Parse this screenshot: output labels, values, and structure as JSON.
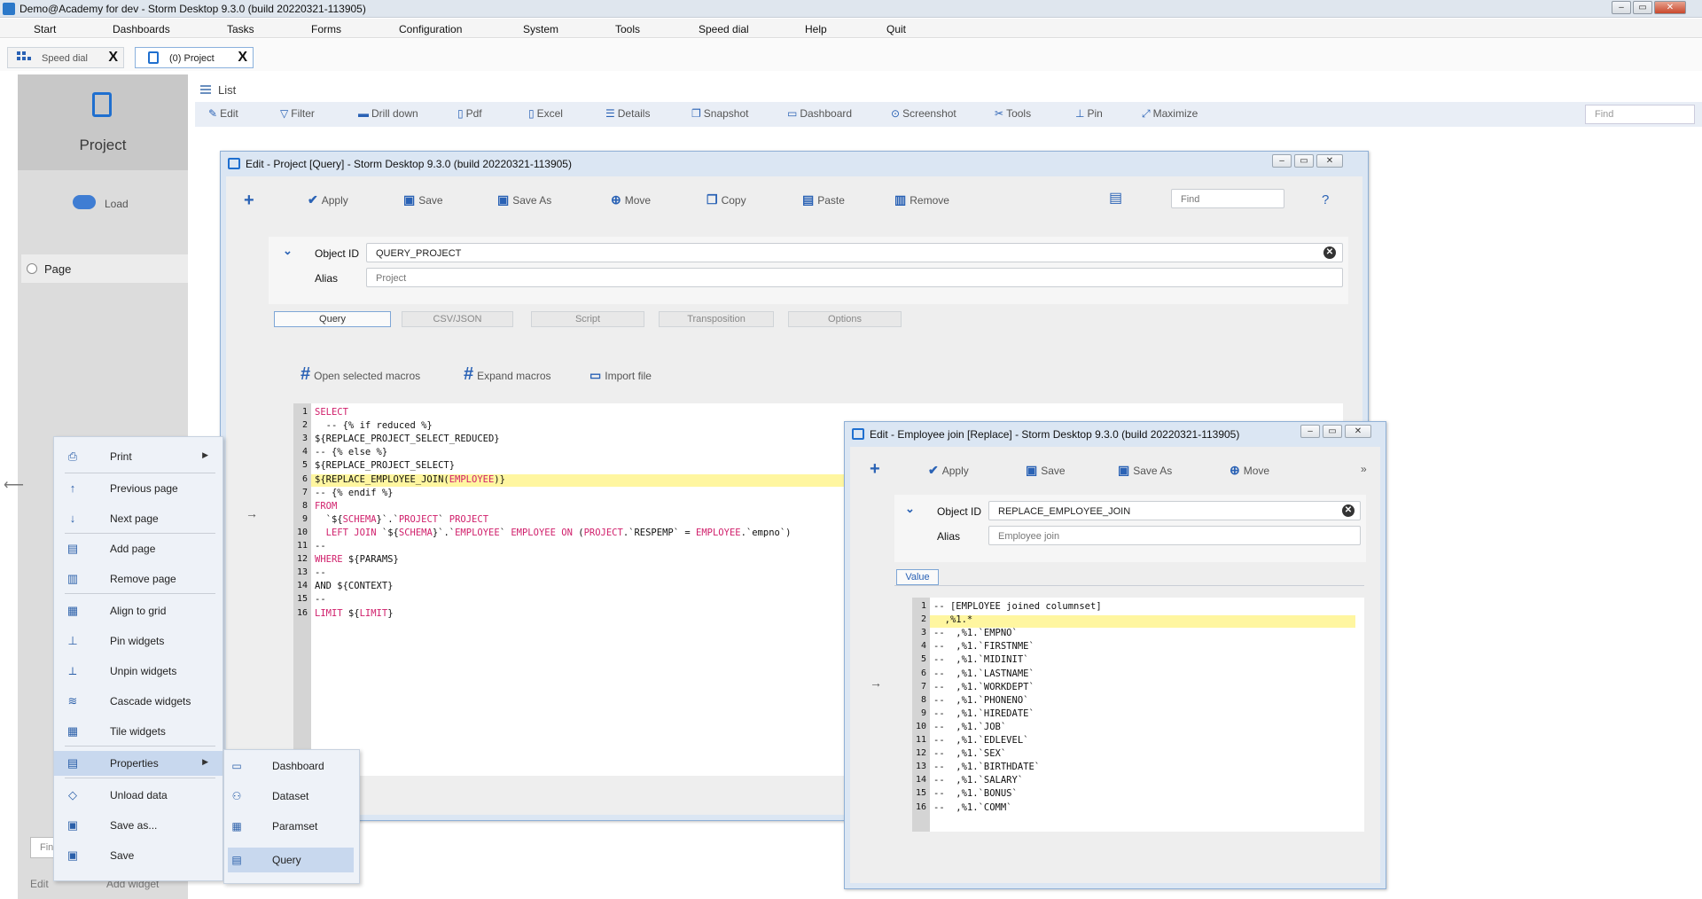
{
  "window": {
    "title": "Demo@Academy for dev -  Storm Desktop 9.3.0 (build 20220321-113905)",
    "controls": [
      "‒",
      "▭",
      "✕"
    ]
  },
  "menu": [
    "Start",
    "Dashboards",
    "Tasks",
    "Forms",
    "Configuration",
    "System",
    "Tools",
    "Speed dial",
    "Help",
    "Quit"
  ],
  "tabs": [
    {
      "label": "Speed dial",
      "close": "X"
    },
    {
      "label": "(0) Project",
      "close": "X"
    }
  ],
  "left_panel": {
    "title": "Project",
    "load_label": "Load",
    "page_label": "Page",
    "find_stub": "Fin",
    "edit_label": "Edit",
    "add_widget_label": "Add widget"
  },
  "list": {
    "label": "List",
    "toolbar": [
      "Edit",
      "Filter",
      "Drill down",
      "Pdf",
      "Excel",
      "Details",
      "Snapshot",
      "Dashboard",
      "Screenshot",
      "Tools",
      "Pin",
      "Maximize"
    ],
    "find_placeholder": "Find"
  },
  "dialog_project": {
    "title": "Edit - Project [Query] -  Storm Desktop 9.3.0 (build 20220321-113905)",
    "toolbar": [
      "Apply",
      "Save",
      "Save As",
      "Move",
      "Copy",
      "Paste",
      "Remove"
    ],
    "find_placeholder": "Find",
    "help": "?",
    "object_id_label": "Object ID",
    "object_id_value": "QUERY_PROJECT",
    "alias_label": "Alias",
    "alias_placeholder": "Project",
    "subtabs": [
      "Query",
      "CSV/JSON",
      "Script",
      "Transposition",
      "Options"
    ],
    "macros": [
      "Open selected macros",
      "Expand macros",
      "Import file"
    ],
    "code": [
      "SELECT",
      "  -- {% if reduced %}",
      "${REPLACE_PROJECT_SELECT_REDUCED}",
      "-- {% else %}",
      "${REPLACE_PROJECT_SELECT}",
      "${REPLACE_EMPLOYEE_JOIN(EMPLOYEE)}",
      "-- {% endif %}",
      "FROM",
      "  `${SCHEMA}`.`PROJECT` PROJECT",
      "  LEFT JOIN `${SCHEMA}`.`EMPLOYEE` EMPLOYEE ON (PROJECT.`RESPEMP` = EMPLOYEE.`empno`)",
      "--",
      "WHERE ${PARAMS}",
      "--",
      "AND ${CONTEXT}",
      "--",
      "LIMIT ${LIMIT}"
    ]
  },
  "dialog_employee": {
    "title": "Edit - Employee join [Replace] -  Storm Desktop 9.3.0 (build 20220321-113905)",
    "toolbar": [
      "Apply",
      "Save",
      "Save As",
      "Move"
    ],
    "more": "»",
    "object_id_label": "Object ID",
    "object_id_value": "REPLACE_EMPLOYEE_JOIN",
    "alias_label": "Alias",
    "alias_placeholder": "Employee join",
    "value_tab": "Value",
    "code": [
      "-- [EMPLOYEE joined columnset]",
      "  ,%1.*",
      "--  ,%1.`EMPNO`",
      "--  ,%1.`FIRSTNME`",
      "--  ,%1.`MIDINIT`",
      "--  ,%1.`LASTNAME`",
      "--  ,%1.`WORKDEPT`",
      "--  ,%1.`PHONENO`",
      "--  ,%1.`HIREDATE`",
      "--  ,%1.`JOB`",
      "--  ,%1.`EDLEVEL`",
      "--  ,%1.`SEX`",
      "--  ,%1.`BIRTHDATE`",
      "--  ,%1.`SALARY`",
      "--  ,%1.`BONUS`",
      "--  ,%1.`COMM`"
    ]
  },
  "context_menu": [
    "Print",
    "Previous page",
    "Next page",
    "Add page",
    "Remove page",
    "Align to grid",
    "Pin widgets",
    "Unpin widgets",
    "Cascade widgets",
    "Tile widgets",
    "Properties",
    "Unload data",
    "Save as...",
    "Save"
  ],
  "submenu": [
    "Dashboard",
    "Dataset",
    "Paramset",
    "Query"
  ],
  "accent": "#1f6fcf"
}
